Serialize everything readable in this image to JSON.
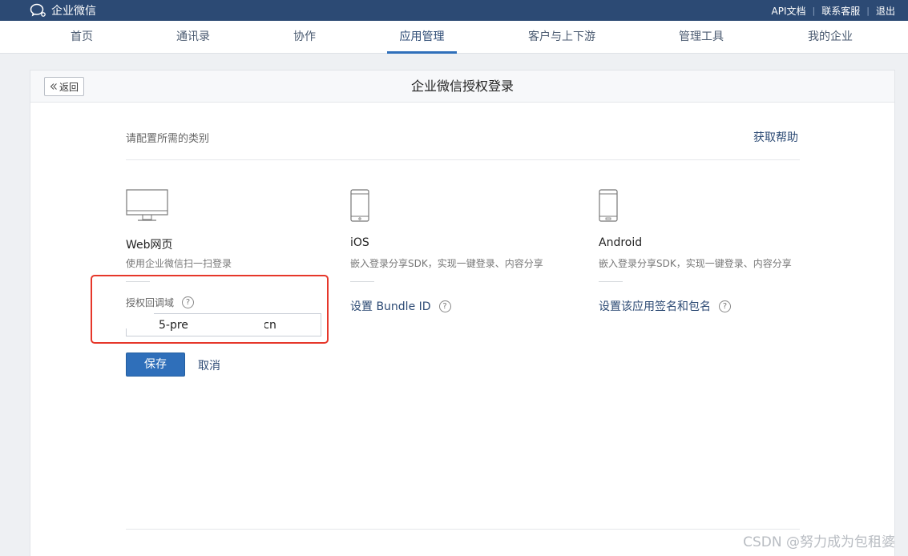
{
  "header": {
    "app_name": "企业微信",
    "links": [
      "API文档",
      "联系客服",
      "退出"
    ]
  },
  "nav": {
    "items": [
      "首页",
      "通讯录",
      "协作",
      "应用管理",
      "客户与上下游",
      "管理工具",
      "我的企业"
    ],
    "active": "应用管理"
  },
  "panel": {
    "back_label": "返回",
    "title": "企业微信授权登录",
    "section_label": "请配置所需的类别",
    "help_link": "获取帮助"
  },
  "platforms": {
    "web": {
      "title": "Web网页",
      "desc": "使用企业微信扫一扫登录",
      "field_label": "授权回调域",
      "field_value": "5-pre                    .cn",
      "save": "保存",
      "cancel": "取消"
    },
    "ios": {
      "title": "iOS",
      "desc": "嵌入登录分享SDK，实现一键登录、内容分享",
      "link": "设置 Bundle ID"
    },
    "android": {
      "title": "Android",
      "desc": "嵌入登录分享SDK，实现一键登录、内容分享",
      "link": "设置该应用签名和包名"
    }
  },
  "help_icon": "?",
  "watermark": "CSDN @努力成为包租婆",
  "colors": {
    "topbar": "#2c4a74",
    "primary": "#2f6fba",
    "link": "#2c4a74",
    "highlight": "#e6372a"
  }
}
